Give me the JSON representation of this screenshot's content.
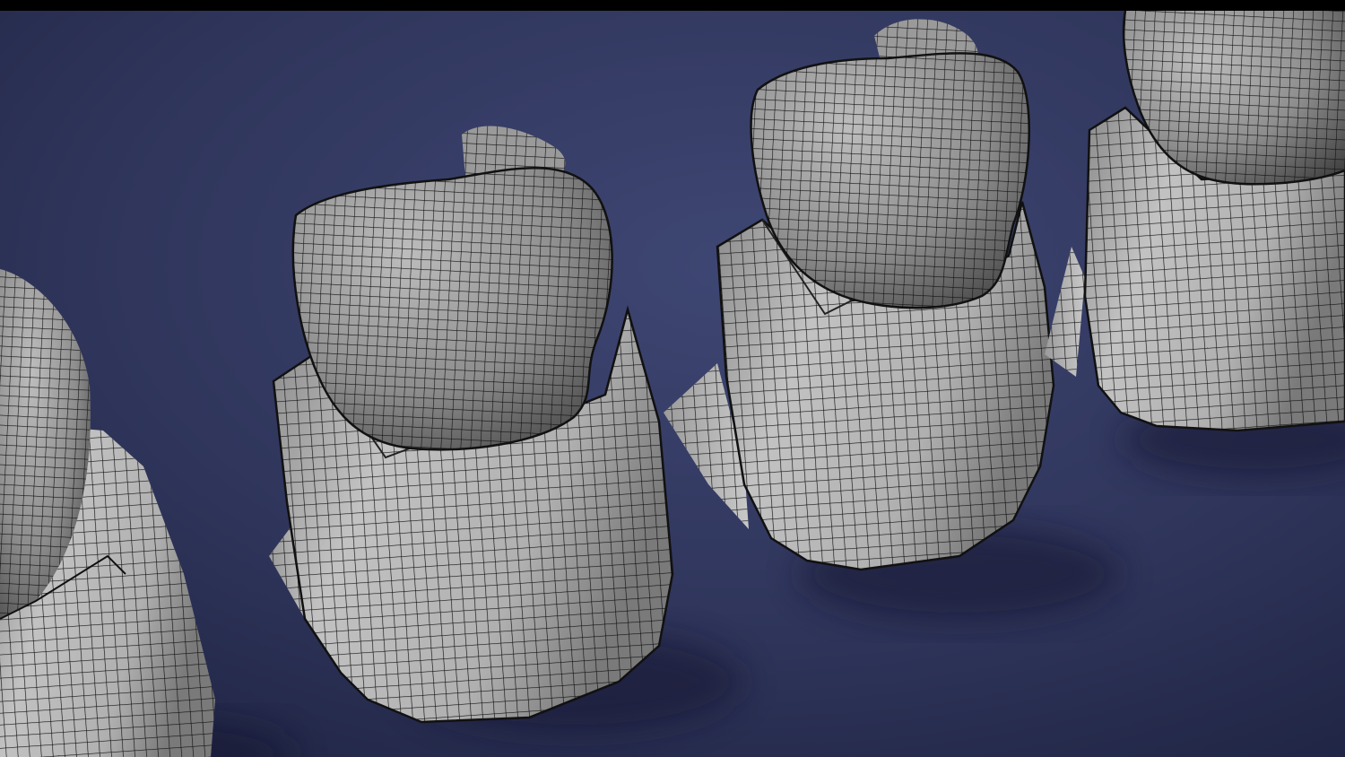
{
  "scene": {
    "description_free": true,
    "colors": {
      "backdrop_light": "#3c4470",
      "backdrop_dark": "#1f2441",
      "mesh_light": "#b9b9b9",
      "mesh_mid": "#8e8e8e",
      "mesh_dark": "#4a4a4a",
      "wire": "#111111",
      "letterbox": "#000000"
    },
    "objects": [
      {
        "name": "tooth-model-1"
      },
      {
        "name": "tooth-model-2"
      },
      {
        "name": "tooth-model-3"
      },
      {
        "name": "tooth-model-4"
      }
    ]
  }
}
